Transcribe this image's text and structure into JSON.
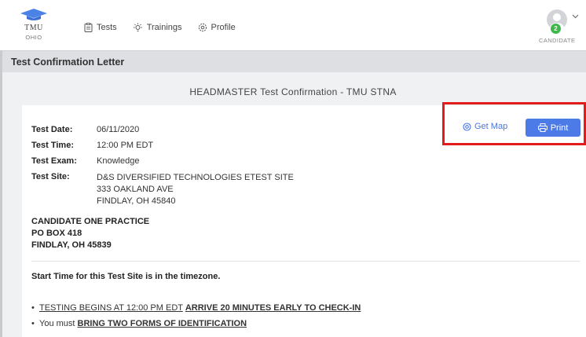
{
  "brand": {
    "name": "TMU",
    "sub": "OHIO"
  },
  "nav": [
    {
      "label": "Tests",
      "icon": "clipboard-icon"
    },
    {
      "label": "Trainings",
      "icon": "lightbulb-icon"
    },
    {
      "label": "Profile",
      "icon": "gear-icon"
    }
  ],
  "user": {
    "badge": "2",
    "role": "CANDIDATE"
  },
  "page_title": "Test Confirmation Letter",
  "letter_title": "HEADMASTER Test Confirmation - TMU STNA",
  "details": {
    "date_label": "Test Date:",
    "date": "06/11/2020",
    "time_label": "Test Time:",
    "time": "12:00 PM EDT",
    "exam_label": "Test Exam:",
    "exam": "Knowledge",
    "site_label": "Test Site:",
    "site_name": "D&S DIVERSIFIED TECHNOLOGIES ETEST SITE",
    "site_street": "333 OAKLAND AVE",
    "site_city": "FINDLAY, OH 45840"
  },
  "candidate": {
    "name": "CANDIDATE ONE PRACTICE",
    "po": "PO BOX 418",
    "city": "FINDLAY, OH 45839"
  },
  "start_note": "Start Time for this Test Site is in the timezone.",
  "bullets": {
    "b1_part1": "TESTING BEGINS AT 12:00 PM EDT",
    "b1_part2": "ARRIVE 20 MINUTES EARLY TO CHECK-IN",
    "b2_part1": "You must",
    "b2_part2": "BRING TWO FORMS OF IDENTIFICATION"
  },
  "actions": {
    "map_label": "Get Map",
    "print_label": "Print"
  },
  "colors": {
    "accent": "#4c7be8",
    "highlight": "#e21b1b",
    "badge": "#3db84a"
  }
}
